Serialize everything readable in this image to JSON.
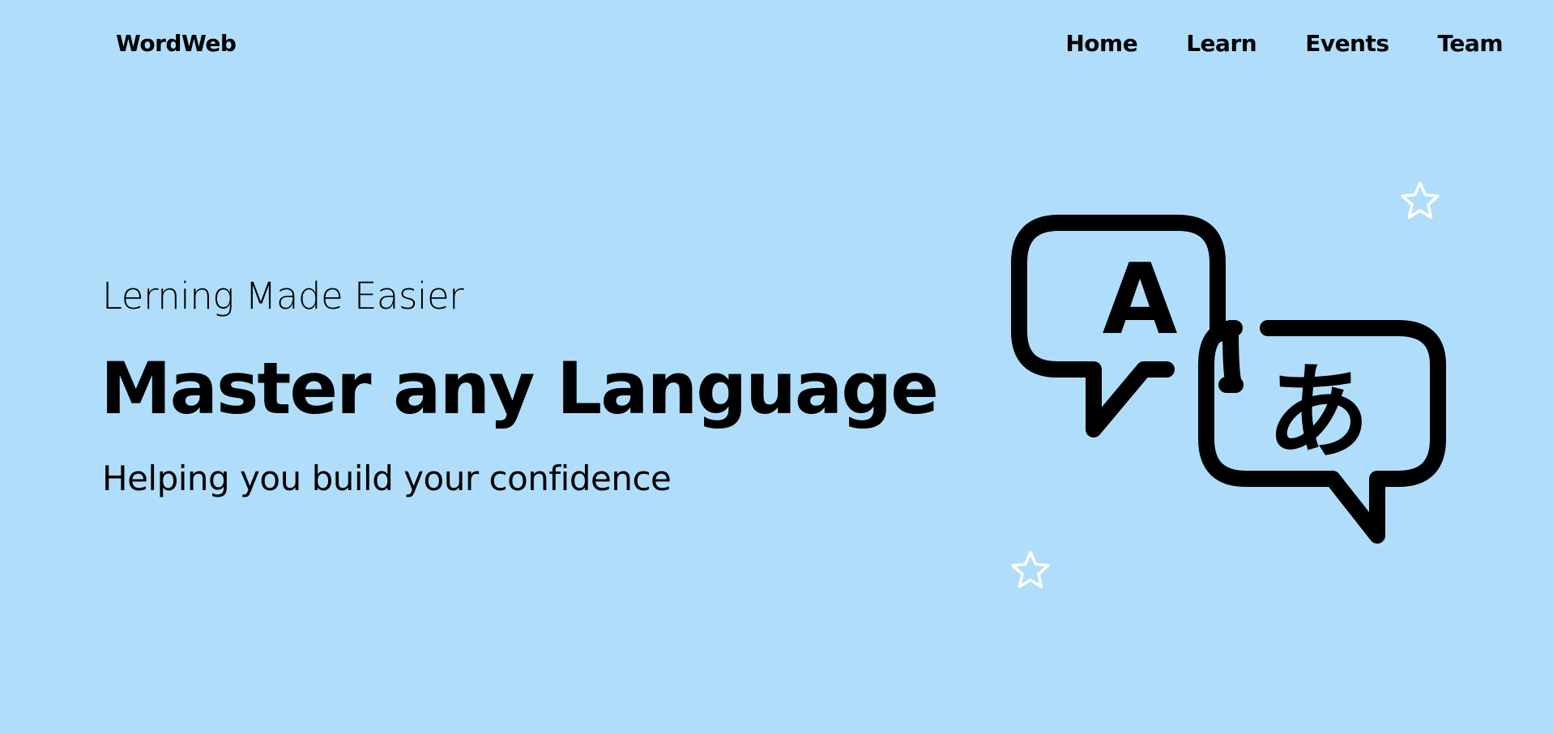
{
  "header": {
    "brand": "WordWeb",
    "nav": [
      {
        "label": "Home"
      },
      {
        "label": "Learn"
      },
      {
        "label": "Events"
      },
      {
        "label": "Team"
      }
    ]
  },
  "hero": {
    "tagline": "Lerning Made Easier",
    "headline": "Master any Language",
    "subline": "Helping you build your confidence"
  },
  "illustration": {
    "icon": "translate-chat-bubbles-icon",
    "glyph_left": "A",
    "glyph_right": "あ"
  },
  "decor": {
    "icons": [
      "star-outline-icon",
      "star-outline-icon"
    ]
  },
  "colors": {
    "background": "#b0defa",
    "text": "#000000",
    "star": "#ffffff"
  }
}
